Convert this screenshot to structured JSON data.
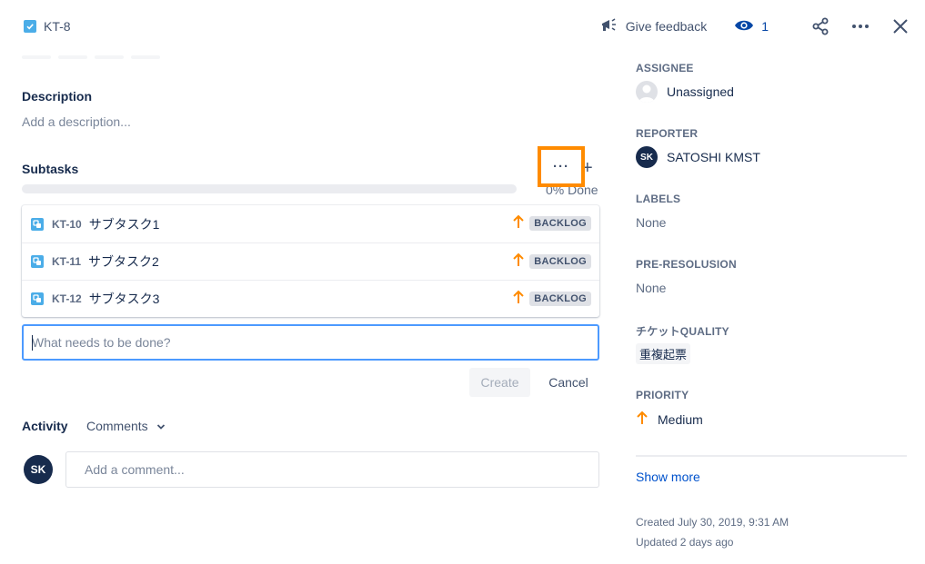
{
  "header": {
    "issue_key": "KT-8",
    "feedback_label": "Give feedback",
    "watch_count": "1"
  },
  "description": {
    "title": "Description",
    "placeholder": "Add a description..."
  },
  "subtasks": {
    "title": "Subtasks",
    "more_label": "···",
    "add_label": "+",
    "progress_percent": 0,
    "progress_label": "0% Done",
    "items": [
      {
        "key": "KT-10",
        "summary": "サブタスク1",
        "status": "BACKLOG"
      },
      {
        "key": "KT-11",
        "summary": "サブタスク2",
        "status": "BACKLOG"
      },
      {
        "key": "KT-12",
        "summary": "サブタスク3",
        "status": "BACKLOG"
      }
    ],
    "new_placeholder": "What needs to be done?",
    "create_label": "Create",
    "cancel_label": "Cancel"
  },
  "activity": {
    "title": "Activity",
    "filter_label": "Comments",
    "user_initials": "SK",
    "comment_placeholder": "Add a comment..."
  },
  "fields": {
    "assignee_label": "ASSIGNEE",
    "assignee_value": "Unassigned",
    "reporter_label": "REPORTER",
    "reporter_initials": "SK",
    "reporter_value": "SATOSHI KMST",
    "labels_label": "LABELS",
    "labels_value": "None",
    "preres_label": "PRE-RESOLUSION",
    "preres_value": "None",
    "quality_label": "チケットQUALITY",
    "quality_value": "重複起票",
    "priority_label": "PRIORITY",
    "priority_value": "Medium"
  },
  "show_more_label": "Show more",
  "meta": {
    "created": "Created July 30, 2019, 9:31 AM",
    "updated": "Updated 2 days ago"
  },
  "colors": {
    "accent": "#0052cc",
    "highlight": "#ff8b00",
    "priority_medium": "#ff8b00",
    "issue_type": "#4bade8"
  }
}
